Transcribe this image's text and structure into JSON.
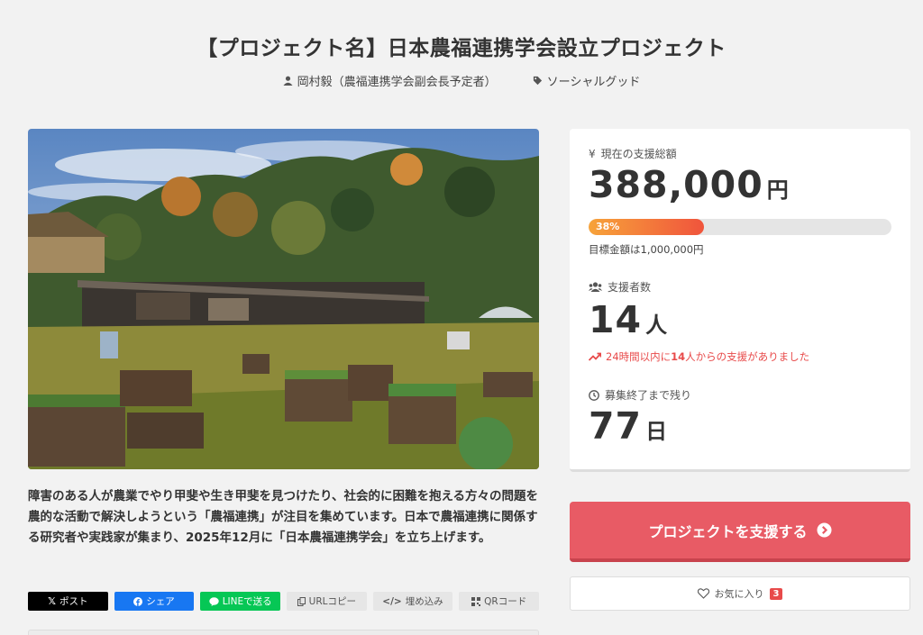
{
  "project": {
    "title": "【プロジェクト名】日本農福連携学会設立プロジェクト",
    "owner": "岡村毅（農福連携学会副会長予定者）",
    "category": "ソーシャルグッド"
  },
  "description": "障害のある人が農業でやり甲斐や生き甲斐を見つけたり、社会的に困難を抱える方々の問題を農的な活動で解決しようという「農福連携」が注目を集めています。日本で農福連携に関係する研究者や実践家が集まり、2025年12月に「日本農福連携学会」を立ち上げます。",
  "share": {
    "x": "ポスト",
    "facebook": "シェア",
    "line": "LINEで送る",
    "url": "URLコピー",
    "embed": "埋め込み",
    "qr": "QRコード"
  },
  "stats": {
    "total_label": "現在の支援総額",
    "total_amount": "388,000",
    "total_unit": "円",
    "progress_percent": 38,
    "progress_label": "38%",
    "goal_text": "目標金額は1,000,000円",
    "supporters_label": "支援者数",
    "supporters_count": "14",
    "supporters_unit": "人",
    "trend_prefix": "24時間以内に",
    "trend_count": "14",
    "trend_suffix": "人からの支援がありました",
    "remaining_label": "募集終了まで残り",
    "remaining_days": "77",
    "remaining_unit": "日"
  },
  "actions": {
    "support_label": "プロジェクトを支援する",
    "favorite_label": "お気に入り",
    "favorite_count": "3"
  },
  "colors": {
    "accent": "#e85b65",
    "progress_start": "#f7a33a",
    "progress_end": "#f0543c",
    "trend": "#e84a4a"
  }
}
